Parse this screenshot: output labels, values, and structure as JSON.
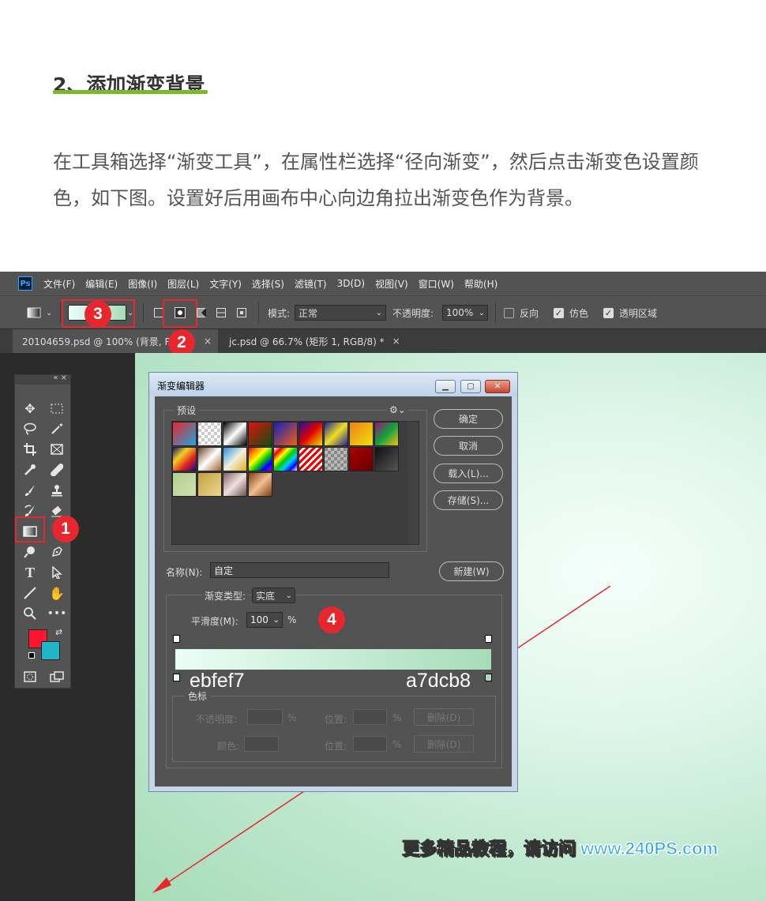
{
  "article": {
    "title": "2、添加渐变背景",
    "paragraph": "在工具箱选择“渐变工具”，在属性栏选择“径向渐变”，然后点击渐变色设置颜色，如下图。设置好后用画布中心向边角拉出渐变色作为背景。"
  },
  "app": {
    "logo": "Ps",
    "menu": [
      "文件(F)",
      "编辑(E)",
      "图像(I)",
      "图层(L)",
      "文字(Y)",
      "选择(S)",
      "滤镜(T)",
      "3D(D)",
      "视图(V)",
      "窗口(W)",
      "帮助(H)"
    ],
    "options": {
      "mode_label": "模式:",
      "mode_value": "正常",
      "opacity_label": "不透明度:",
      "opacity_value": "100%",
      "reverse_label": "反向",
      "dither_label": "仿色",
      "transparency_label": "透明区域",
      "reverse_checked": false,
      "dither_checked": true,
      "transparency_checked": true
    },
    "tabs": [
      {
        "label": "20104659.psd @ 100% (背景, R",
        "close": "×"
      },
      {
        "label": "jc.psd @ 66.7% (矩形 1, RGB/8) *",
        "close": "×"
      }
    ],
    "colors": {
      "foreground": "#ff1530",
      "background": "#1fb5c6",
      "grad_start": "#ebfef7",
      "grad_end": "#a7dcb8"
    }
  },
  "annotations": {
    "badge1": "1",
    "badge2": "2",
    "badge3": "3",
    "badge4": "4"
  },
  "dialog": {
    "title": "渐变编辑器",
    "presets_label": "预设",
    "ok_label": "确定",
    "cancel_label": "取消",
    "load_label": "载入(L)...",
    "save_label": "存储(S)...",
    "name_label": "名称(N):",
    "name_value": "自定",
    "new_label": "新建(W)",
    "type_label": "渐变类型:",
    "type_value": "实底",
    "smooth_label": "平滑度(M):",
    "smooth_value": "100",
    "percent": "%",
    "color_start_hex": "ebfef7",
    "color_end_hex": "a7dcb8",
    "stops_label": "色标",
    "stop_opacity_label": "不透明度:",
    "stop_location_label": "位置:",
    "stop_delete_label": "删除(D)",
    "stop_color_label": "颜色:"
  },
  "watermark": {
    "cn": "更多精品教程，请访问",
    "url": "www.240PS.com"
  }
}
